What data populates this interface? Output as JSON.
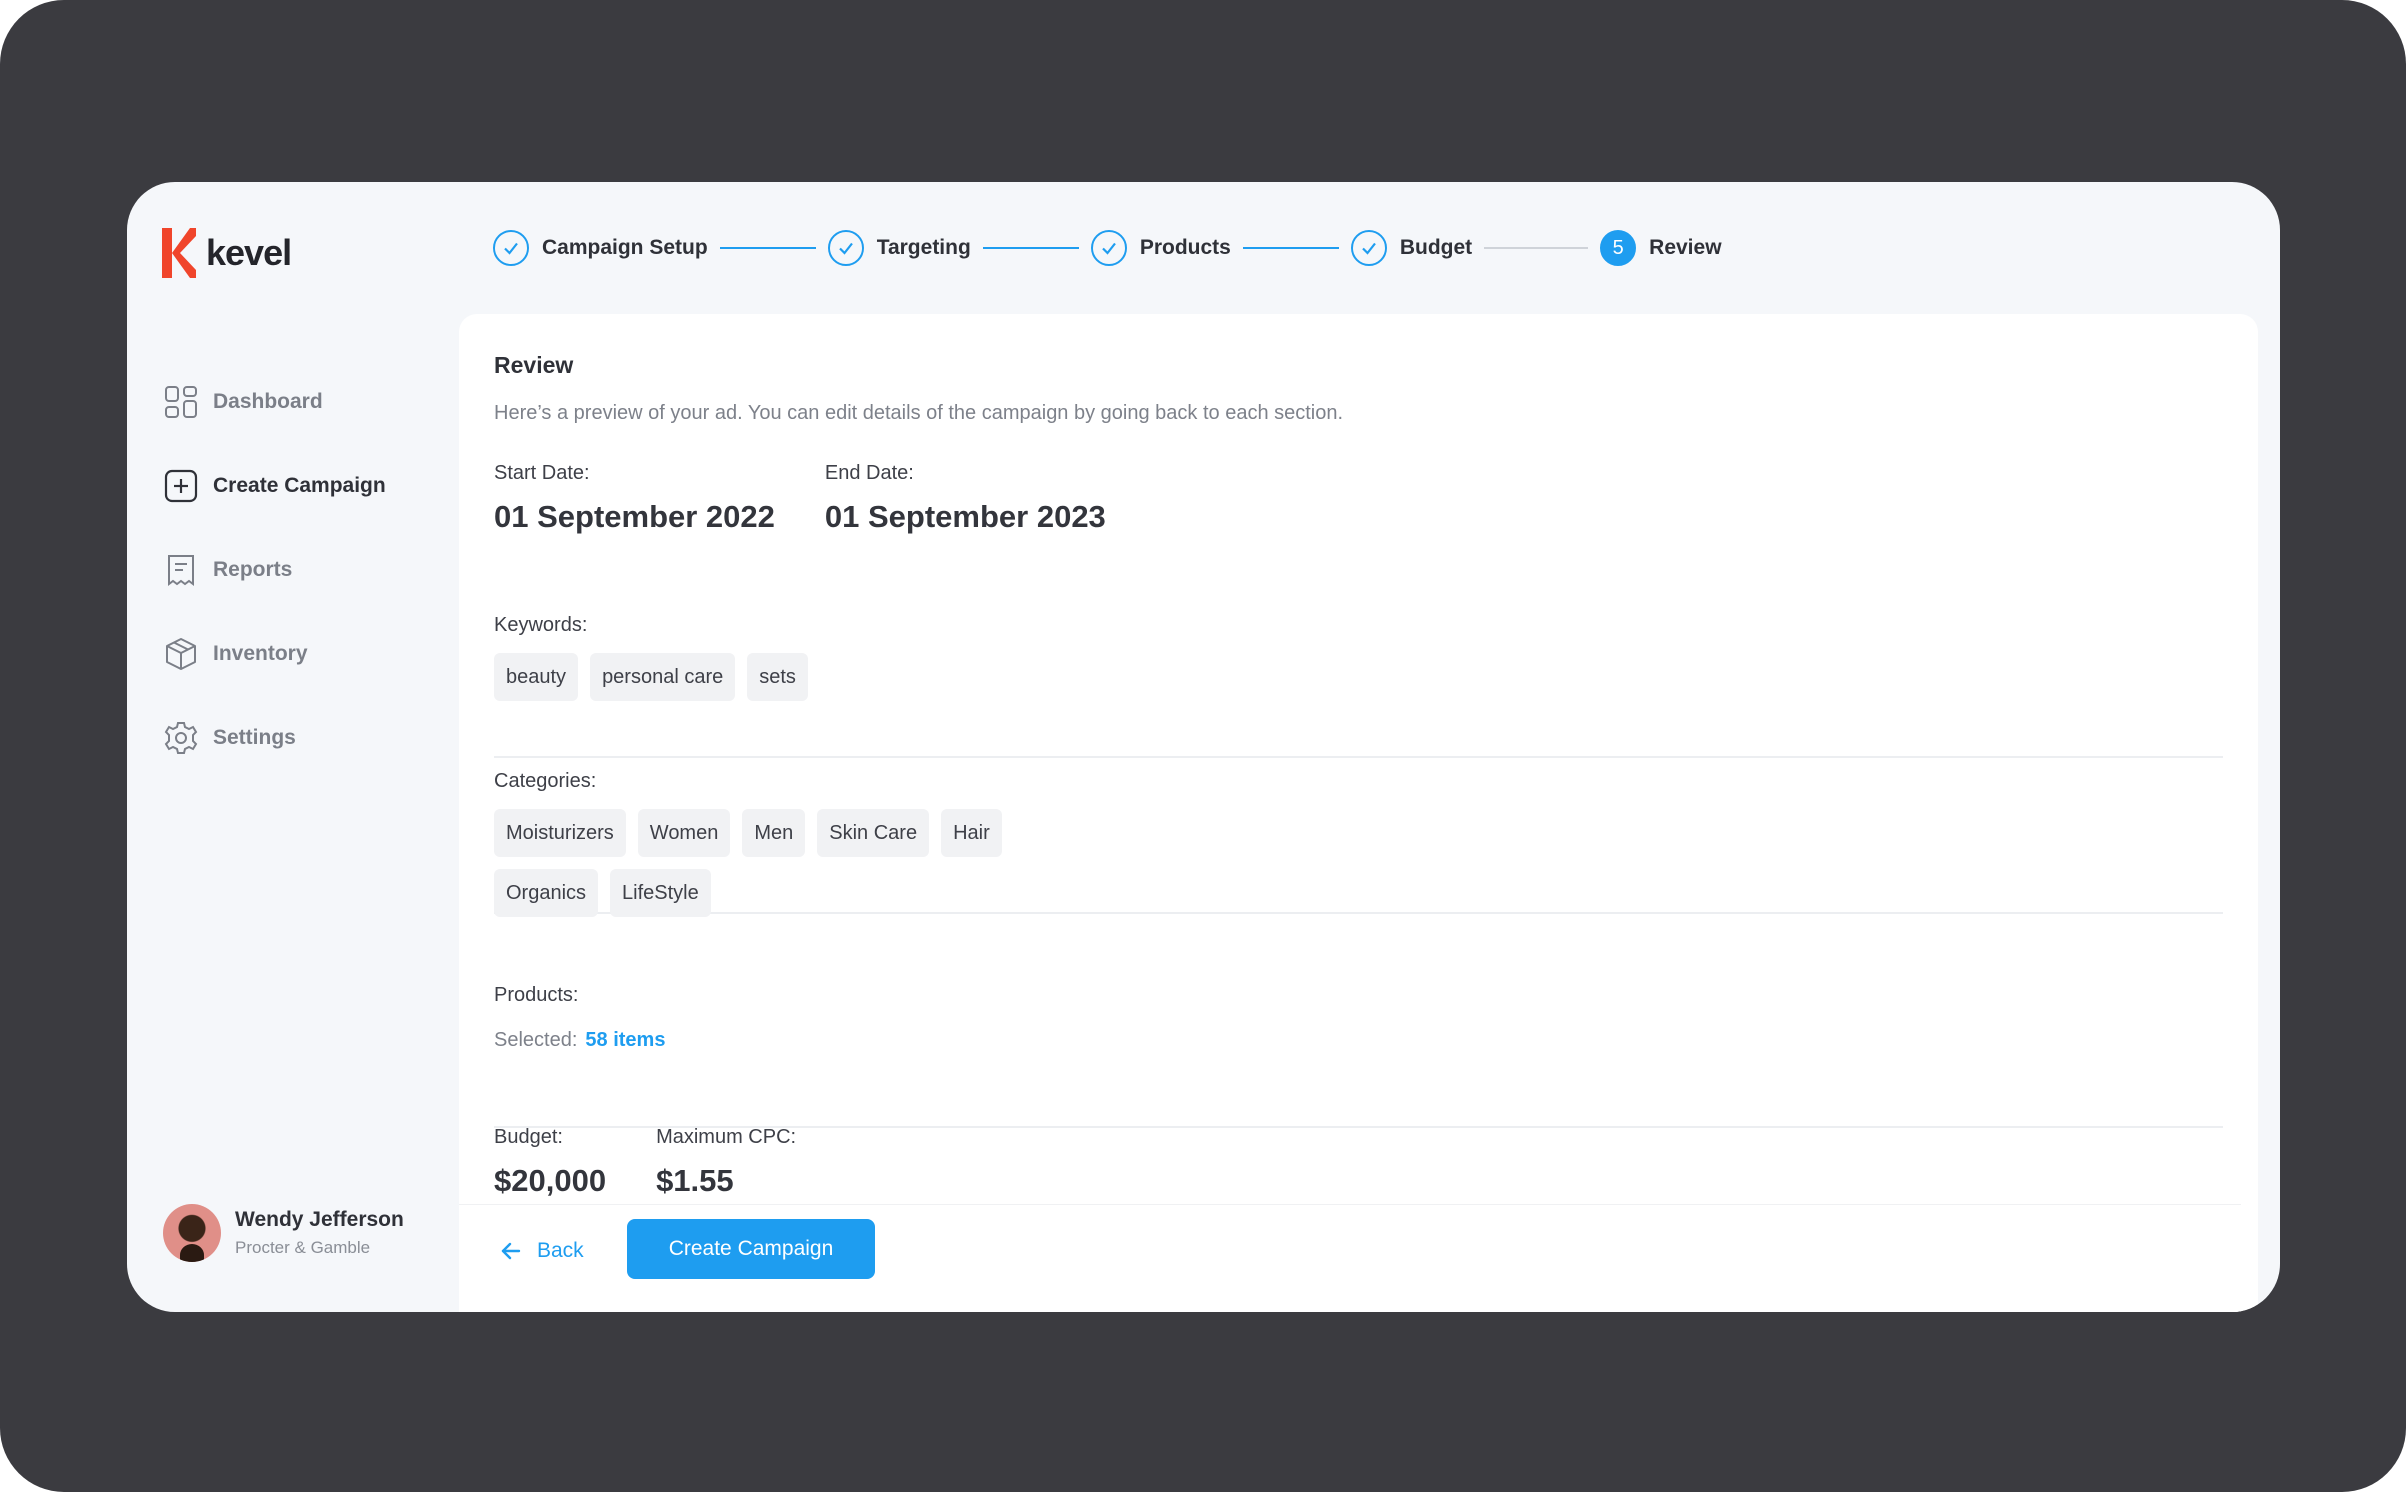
{
  "brand": {
    "name": "kevel",
    "mark_color": "#f0452b"
  },
  "sidebar": {
    "items": [
      {
        "label": "Dashboard",
        "icon": "grid-icon",
        "active": false
      },
      {
        "label": "Create Campaign",
        "icon": "plus-square-icon",
        "active": true
      },
      {
        "label": "Reports",
        "icon": "receipt-icon",
        "active": false
      },
      {
        "label": "Inventory",
        "icon": "box-icon",
        "active": false
      },
      {
        "label": "Settings",
        "icon": "gear-icon",
        "active": false
      }
    ]
  },
  "user": {
    "name": "Wendy Jefferson",
    "org": "Procter & Gamble"
  },
  "stepper": {
    "steps": [
      {
        "label": "Campaign Setup",
        "state": "done"
      },
      {
        "label": "Targeting",
        "state": "done"
      },
      {
        "label": "Products",
        "state": "done"
      },
      {
        "label": "Budget",
        "state": "done"
      },
      {
        "label": "Review",
        "state": "current",
        "number": "5"
      }
    ]
  },
  "review": {
    "title": "Review",
    "subtitle": "Here’s a preview of your ad. You can edit details of the campaign by going back to each section.",
    "start_label": "Start Date:",
    "start_value": "01 September 2022",
    "end_label": "End Date:",
    "end_value": "01 September 2023",
    "keywords_label": "Keywords:",
    "keywords": [
      "beauty",
      "personal care",
      "sets"
    ],
    "categories_label": "Categories:",
    "categories": [
      "Moisturizers",
      "Women",
      "Men",
      "Skin Care",
      "Hair",
      "Organics",
      "LifeStyle"
    ],
    "products_label": "Products:",
    "selected_label": "Selected:",
    "selected_value": "58 items",
    "budget_label": "Budget:",
    "budget_value": "$20,000",
    "cpc_label": "Maximum CPC:",
    "cpc_value": "$1.55"
  },
  "actions": {
    "back_label": "Back",
    "create_label": "Create Campaign"
  },
  "colors": {
    "accent": "#1e9df0",
    "frame": "#3b3b40",
    "app_bg": "#f5f7fa"
  }
}
